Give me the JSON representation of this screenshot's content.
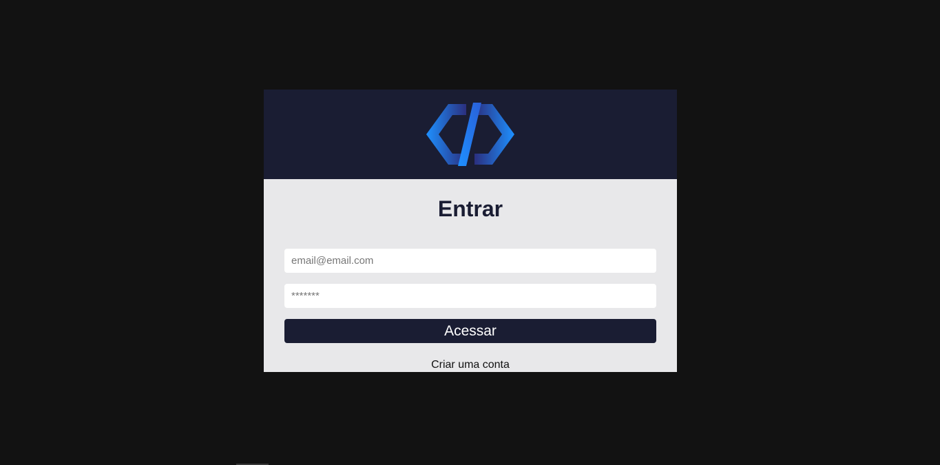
{
  "header": {
    "logo_icon": "code-brackets-logo-icon",
    "logo_colors": [
      "#1e90ff",
      "#2a2f7a"
    ]
  },
  "login": {
    "title": "Entrar",
    "email_placeholder": "email@email.com",
    "password_placeholder": "*******",
    "submit_label": "Acessar",
    "create_account_label": "Criar uma conta"
  },
  "colors": {
    "page_background": "#121212",
    "header_background": "#1a1d33",
    "card_background": "#e8e8ea",
    "button_background": "#1a1d33"
  }
}
